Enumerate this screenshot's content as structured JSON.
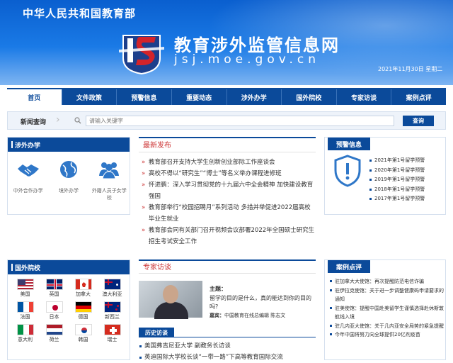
{
  "header": {
    "ministry": "中华人民共和国教育部",
    "site_name": "教育涉外监管信息网",
    "domain": "jsj.moe.gov.cn",
    "date": "2021年11月30日 星期二"
  },
  "nav": [
    {
      "label": "首页",
      "active": true
    },
    {
      "label": "文件政策"
    },
    {
      "label": "预警信息"
    },
    {
      "label": "重要动态"
    },
    {
      "label": "涉外办学"
    },
    {
      "label": "国外院校"
    },
    {
      "label": "专家访谈"
    },
    {
      "label": "案例点评"
    }
  ],
  "search": {
    "title": "新闻查询",
    "placeholder": "请输入关键字",
    "button": "查询"
  },
  "foreign_schooling": {
    "title": "涉外办学",
    "items": [
      {
        "label": "中外合作办学",
        "icon": "handshake-icon"
      },
      {
        "label": "境外办学",
        "icon": "globe-icon"
      },
      {
        "label": "外籍人员子女学校",
        "icon": "people-icon"
      }
    ]
  },
  "latest": {
    "title": "最新发布",
    "items": [
      "教育部召开支持大学生创新创业部际工作座谈会",
      "高校不得以“研究生”“博士”等名义举办课程进修班",
      "怀进鹏：深入学习贯彻党的十九届六中全会精神 加快建设教育强国",
      "教育部举行“校园招聘月”系列活动 多措并举促进2022届高校毕业生就业",
      "教育部会同有关部门召开视频会议部署2022年全国硕士研究生招生考试安全工作"
    ]
  },
  "warnings": {
    "title": "预警信息",
    "items": [
      "2021年第1号留学预警",
      "2020年第1号留学预警",
      "2019年第1号留学预警",
      "2018年第1号留学预警",
      "2017年第1号留学预警"
    ]
  },
  "schools": {
    "title": "国外院校",
    "countries": [
      "美国",
      "英国",
      "加拿大",
      "澳大利亚",
      "法国",
      "日本",
      "德国",
      "新西兰",
      "意大利",
      "荷兰",
      "韩国",
      "瑞士"
    ]
  },
  "expert": {
    "title": "专家访谈",
    "topic_label": "主题：",
    "topic": "留学的目的是什么，真的能达到你的目的吗?",
    "guest_label": "嘉宾：",
    "guest": "中国教育在线总编辑 陈志文",
    "history_label": "历史访谈",
    "history": [
      "美国弗吉尼亚大学 副教务长访谈",
      "英迪国际大学校长谈“一带一路”下高等教育国际交流"
    ]
  },
  "cases": {
    "title": "案例点评",
    "items": [
      "驻加拿大大使馆：再次提醒防范电信诈骗",
      "驻伊拉克使馆：关于进一步调整健康码申请要求的通知",
      "驻美使馆：提醒中国赴美留学生谨慎选择赴休斯敦航线入境",
      "驻几内亚大使馆：关于几内亚安全局势的紧急提醒",
      "今年中国将努力向全球提供20亿剂疫苗"
    ]
  },
  "colors": {
    "primary": "#0b4a9a",
    "accent": "#cc3333"
  }
}
